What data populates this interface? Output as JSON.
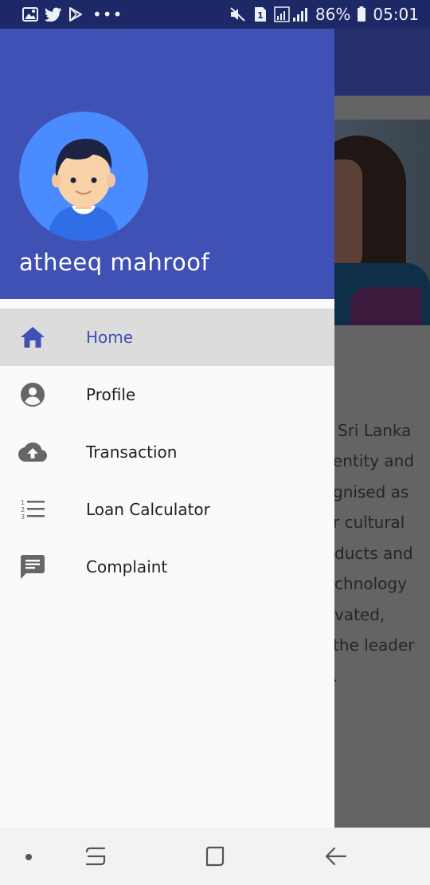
{
  "status_bar": {
    "battery": "86%",
    "time": "05:01",
    "sim_slot": "1",
    "icons": [
      "image-icon",
      "twitter-icon",
      "play-store-icon",
      "more-dots-icon",
      "mute-icon",
      "sim-icon",
      "signal-icon",
      "battery-icon"
    ]
  },
  "drawer": {
    "user_name": "atheeq mahroof",
    "accent_color": "#3f51b5",
    "avatar_bg": "#4a8bff",
    "items": [
      {
        "label": "Home",
        "icon": "home-icon",
        "selected": true
      },
      {
        "label": "Profile",
        "icon": "account-circle-icon",
        "selected": false
      },
      {
        "label": "Transaction",
        "icon": "cloud-upload-icon",
        "selected": false
      },
      {
        "label": "Loan Calculator",
        "icon": "numbered-list-icon",
        "selected": false
      },
      {
        "label": "Complaint",
        "icon": "chat-message-icon",
        "selected": false
      }
    ]
  },
  "background_content": {
    "lines": [
      "Sri Lanka",
      "entity and",
      "gnised as",
      "r cultural",
      "ducts and",
      "chnology",
      "vated,",
      "the leader",
      "."
    ]
  },
  "nav_bar": {
    "buttons": [
      "recents-dot",
      "recent-apps-icon",
      "home-button-icon",
      "back-arrow-icon"
    ]
  }
}
